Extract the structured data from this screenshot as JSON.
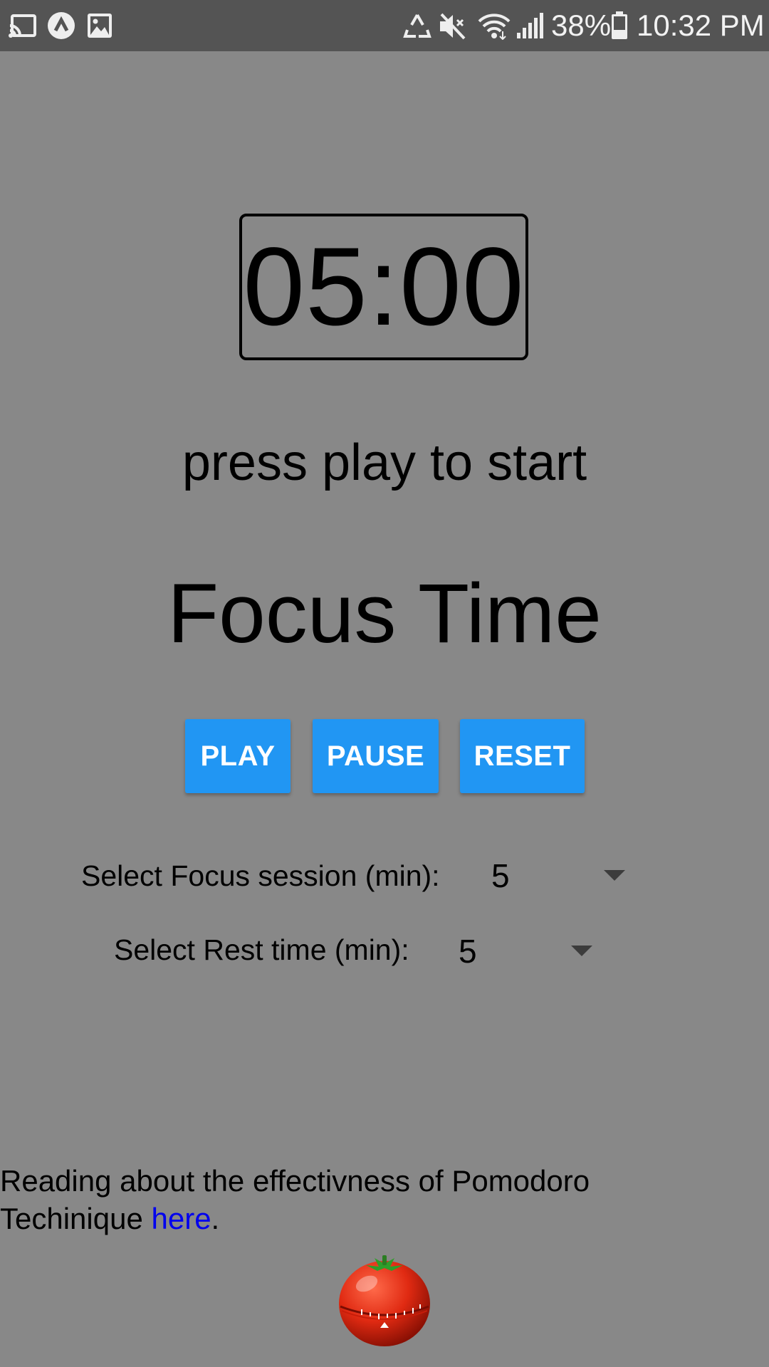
{
  "statusbar": {
    "battery": "38%",
    "time": "10:32 PM",
    "icons": [
      "cast-icon",
      "app-notification-icon",
      "image-icon",
      "recycle-icon",
      "mute-icon",
      "wifi-icon",
      "signal-icon",
      "battery-icon"
    ]
  },
  "timer": {
    "display": "05:00"
  },
  "status_message": "press play to start",
  "mode_title": "Focus Time",
  "buttons": {
    "play": "PLAY",
    "pause": "PAUSE",
    "reset": "RESET"
  },
  "settings": {
    "focus_label": "Select Focus session (min):",
    "focus_value": "5",
    "rest_label": "Select Rest time (min):",
    "rest_value": "5"
  },
  "info": {
    "text": "Reading about the effectivness of Pomodoro Techinique ",
    "link_text": "here",
    "suffix": "."
  },
  "colors": {
    "background": "#888888",
    "statusbar": "#545454",
    "button": "#2196f3",
    "link": "#0000ee"
  }
}
